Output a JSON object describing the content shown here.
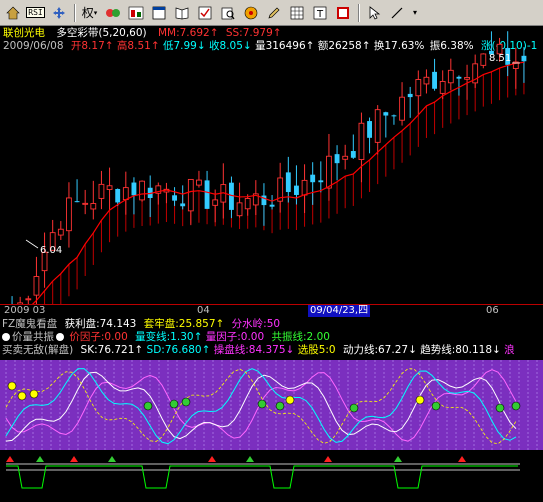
{
  "toolbar": {
    "rsi_label": "RSI",
    "quan_label": "权",
    "icons": [
      "home-icon",
      "rsi-icon",
      "move-icon",
      "weight-icon",
      "indicator-icon",
      "chart-icon",
      "window-icon",
      "book-icon",
      "check-icon",
      "find-icon",
      "alarm-icon",
      "pen-icon",
      "grid-icon",
      "t-icon",
      "zoom-icon",
      "arrow-icon",
      "line-icon",
      "dropdown-icon"
    ]
  },
  "header": {
    "stock_name": "联创光电",
    "indicator_name": "多空彩带(5,20,60)",
    "mm_label": "MM:",
    "mm_value": "7.692",
    "ss_label": "SS:",
    "ss_value": "7.979"
  },
  "quote": {
    "date": "2009/06/08",
    "open_label": "开",
    "open": "8.17",
    "high_label": "高",
    "high": "8.51",
    "low_label": "低",
    "low": "7.99",
    "close_label": "收",
    "close": "8.05",
    "vol_label": "量",
    "vol": "316496",
    "amt_label": "额",
    "amt": "26258",
    "turn_label": "换",
    "turn": "17.63%",
    "amp_label": "振",
    "amp": "6.38%",
    "chg_label": "涨",
    "chg": "(-0.10)-1"
  },
  "price_labels": {
    "high_mark": "8.51",
    "low_mark": "6.04"
  },
  "axis": {
    "labels": [
      "2009 03",
      "04",
      "09/04/23,四",
      "06"
    ]
  },
  "fz": {
    "title": "FZ魔鬼看盘",
    "profit_label": "获利盘:",
    "profit": "74.143",
    "trap_label": "套牢盘:",
    "trap": "25.857",
    "water_label": "分水岭:",
    "water": "50"
  },
  "vp": {
    "title": "价量共振",
    "price_factor_label": "价因子:",
    "price_factor": "0.00",
    "vol_line_label": "量变线:",
    "vol_line": "1.30",
    "vol_factor_label": "量因子:",
    "vol_factor": "0.00",
    "res_label": "共振线:",
    "res": "2.00"
  },
  "mm": {
    "title": "买卖无敌(解盘)",
    "sk_label": "SK:",
    "sk": "76.721",
    "sd_label": "SD:",
    "sd": "76.680",
    "op_label": "操盘线:",
    "op": "84.375",
    "pick_label": "选股",
    "pick": "5:0",
    "power_label": "动力线:",
    "power": "67.27",
    "trend_label": "趋势线:",
    "trend": "80.118",
    "tail": "浪"
  },
  "colors": {
    "up": "#ff3333",
    "down": "#33ccff",
    "ma": "#ff0000",
    "purple": "#7b2fbf"
  },
  "chart_data": {
    "type": "candlestick",
    "x": [
      "2009-03",
      "2009-04",
      "2009-04-23",
      "2009-06"
    ],
    "ylim": [
      6.0,
      8.6
    ],
    "marks": {
      "high": 8.51,
      "low": 6.04
    }
  }
}
